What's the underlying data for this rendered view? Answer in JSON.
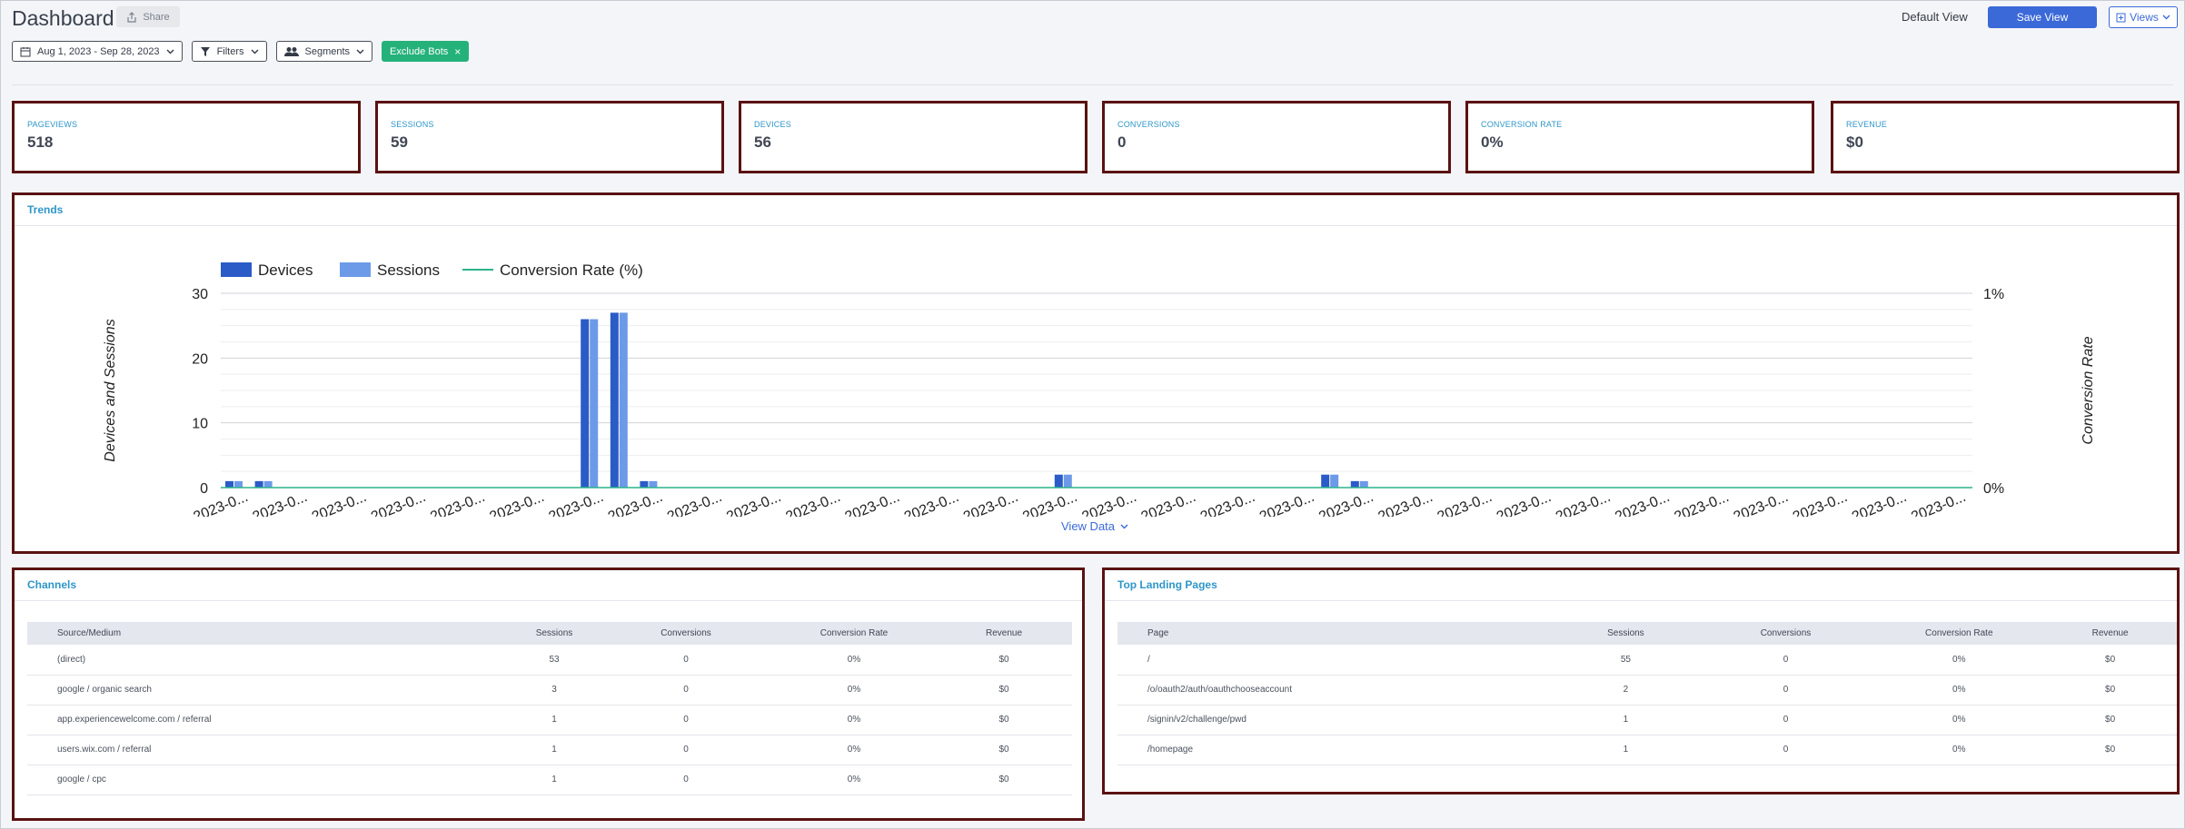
{
  "header": {
    "title": "Dashboard",
    "share_label": "Share",
    "default_view_label": "Default View",
    "save_view_label": "Save View",
    "views_label": "Views"
  },
  "filters": {
    "date_range": "Aug 1, 2023 - Sep 28, 2023",
    "filters_label": "Filters",
    "segments_label": "Segments",
    "exclude_bots_label": "Exclude Bots"
  },
  "kpis": [
    {
      "label": "PAGEVIEWS",
      "value": "518"
    },
    {
      "label": "SESSIONS",
      "value": "59"
    },
    {
      "label": "DEVICES",
      "value": "56"
    },
    {
      "label": "CONVERSIONS",
      "value": "0"
    },
    {
      "label": "CONVERSION RATE",
      "value": "0%"
    },
    {
      "label": "REVENUE",
      "value": "$0"
    }
  ],
  "trends": {
    "title": "Trends",
    "view_data_label": "View Data"
  },
  "chart_data": {
    "type": "bar",
    "legend": [
      "Devices",
      "Sessions",
      "Conversion Rate (%)"
    ],
    "legend_position": "top-left",
    "ylabel_left": "Devices and Sessions",
    "ylabel_right": "Conversion Rate",
    "ylim_left": [
      0,
      30
    ],
    "y_ticks_left": [
      "0",
      "10",
      "20",
      "30"
    ],
    "y_ticks_right": [
      "0%",
      "1%"
    ],
    "x_tick_label": "2023-0...",
    "x_tick_count": 30,
    "grid": true,
    "colors": {
      "devices": "#2a5bc7",
      "sessions": "#6d9ae8",
      "conversion_rate": "#2bb38a"
    },
    "categories_count": 59,
    "series": [
      {
        "name": "Devices",
        "values": [
          1,
          1,
          0,
          0,
          0,
          0,
          0,
          0,
          0,
          0,
          0,
          0,
          26,
          27,
          1,
          0,
          0,
          0,
          0,
          0,
          0,
          0,
          0,
          0,
          0,
          0,
          0,
          0,
          2,
          0,
          0,
          0,
          0,
          0,
          0,
          0,
          0,
          2,
          1,
          0,
          0,
          0,
          0,
          0,
          0,
          0,
          0,
          0,
          0,
          0,
          0,
          0,
          0,
          0,
          0,
          0,
          0,
          0,
          0
        ]
      },
      {
        "name": "Sessions",
        "values": [
          1,
          1,
          0,
          0,
          0,
          0,
          0,
          0,
          0,
          0,
          0,
          0,
          26,
          27,
          1,
          0,
          0,
          0,
          0,
          0,
          0,
          0,
          0,
          0,
          0,
          0,
          0,
          0,
          2,
          0,
          0,
          0,
          0,
          0,
          0,
          0,
          0,
          2,
          1,
          0,
          0,
          0,
          0,
          0,
          0,
          0,
          0,
          0,
          0,
          0,
          0,
          0,
          0,
          0,
          0,
          0,
          0,
          0,
          0
        ]
      },
      {
        "name": "Conversion Rate (%)",
        "constant_value": 0
      }
    ]
  },
  "channels": {
    "title": "Channels",
    "columns": [
      "Source/Medium",
      "Sessions",
      "Conversions",
      "Conversion Rate",
      "Revenue"
    ],
    "rows": [
      [
        "(direct)",
        "53",
        "0",
        "0%",
        "$0"
      ],
      [
        "google / organic search",
        "3",
        "0",
        "0%",
        "$0"
      ],
      [
        "app.experiencewelcome.com / referral",
        "1",
        "0",
        "0%",
        "$0"
      ],
      [
        "users.wix.com / referral",
        "1",
        "0",
        "0%",
        "$0"
      ],
      [
        "google / cpc",
        "1",
        "0",
        "0%",
        "$0"
      ]
    ]
  },
  "landing_pages": {
    "title": "Top Landing Pages",
    "columns": [
      "Page",
      "Sessions",
      "Conversions",
      "Conversion Rate",
      "Revenue"
    ],
    "rows": [
      [
        "/",
        "55",
        "0",
        "0%",
        "$0"
      ],
      [
        "/o/oauth2/auth/oauthchooseaccount",
        "2",
        "0",
        "0%",
        "$0"
      ],
      [
        "/signin/v2/challenge/pwd",
        "1",
        "0",
        "0%",
        "$0"
      ],
      [
        "/homepage",
        "1",
        "0",
        "0%",
        "$0"
      ]
    ]
  }
}
